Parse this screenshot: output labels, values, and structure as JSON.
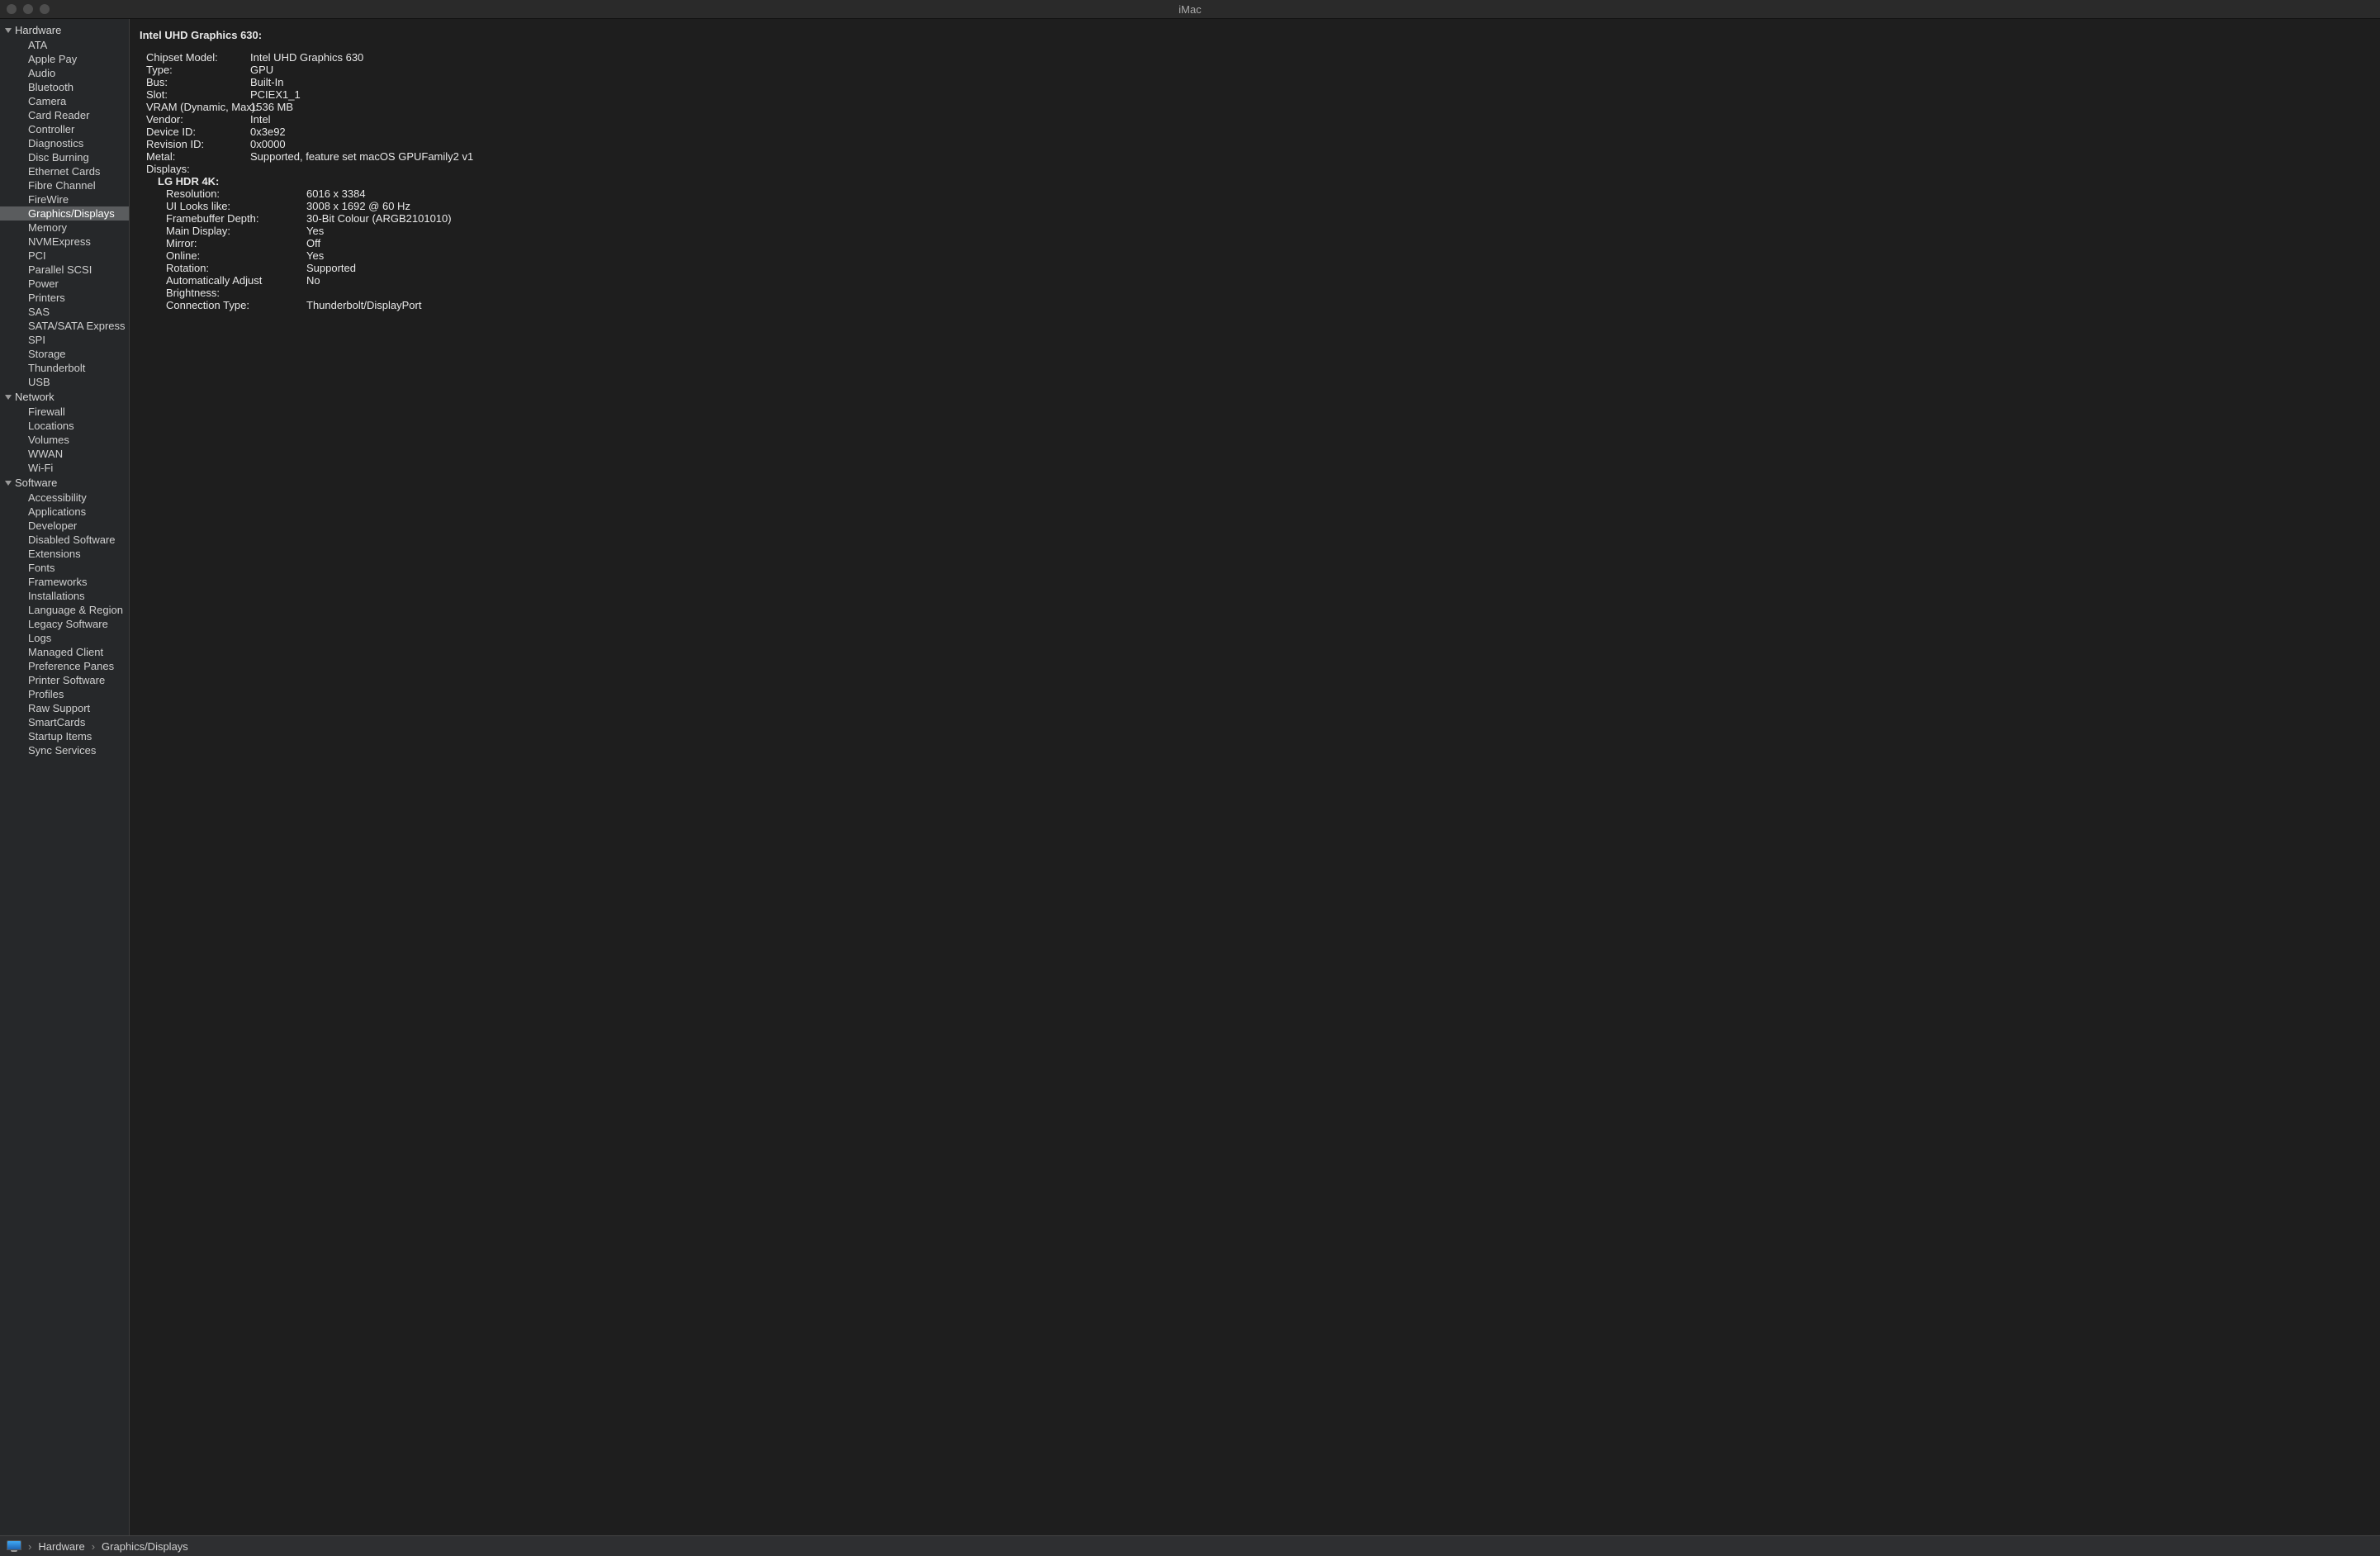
{
  "window": {
    "title": "iMac"
  },
  "sidebar": {
    "sections": [
      {
        "label": "Hardware",
        "items": [
          "ATA",
          "Apple Pay",
          "Audio",
          "Bluetooth",
          "Camera",
          "Card Reader",
          "Controller",
          "Diagnostics",
          "Disc Burning",
          "Ethernet Cards",
          "Fibre Channel",
          "FireWire",
          "Graphics/Displays",
          "Memory",
          "NVMExpress",
          "PCI",
          "Parallel SCSI",
          "Power",
          "Printers",
          "SAS",
          "SATA/SATA Express",
          "SPI",
          "Storage",
          "Thunderbolt",
          "USB"
        ],
        "selected": "Graphics/Displays"
      },
      {
        "label": "Network",
        "items": [
          "Firewall",
          "Locations",
          "Volumes",
          "WWAN",
          "Wi-Fi"
        ]
      },
      {
        "label": "Software",
        "items": [
          "Accessibility",
          "Applications",
          "Developer",
          "Disabled Software",
          "Extensions",
          "Fonts",
          "Frameworks",
          "Installations",
          "Language & Region",
          "Legacy Software",
          "Logs",
          "Managed Client",
          "Preference Panes",
          "Printer Software",
          "Profiles",
          "Raw Support",
          "SmartCards",
          "Startup Items",
          "Sync Services"
        ]
      }
    ]
  },
  "detail": {
    "title": "Intel UHD Graphics 630:",
    "rows": [
      {
        "k": "Chipset Model:",
        "v": "Intel UHD Graphics 630"
      },
      {
        "k": "Type:",
        "v": "GPU"
      },
      {
        "k": "Bus:",
        "v": "Built-In"
      },
      {
        "k": "Slot:",
        "v": "PCIEX1_1"
      },
      {
        "k": "VRAM (Dynamic, Max):",
        "v": "1536 MB"
      },
      {
        "k": "Vendor:",
        "v": "Intel"
      },
      {
        "k": "Device ID:",
        "v": "0x3e92"
      },
      {
        "k": "Revision ID:",
        "v": "0x0000"
      },
      {
        "k": "Metal:",
        "v": "Supported, feature set macOS GPUFamily2 v1"
      }
    ],
    "displays_label": "Displays:",
    "display_name": "LG HDR 4K:",
    "display_rows": [
      {
        "k": "Resolution:",
        "v": "6016 x 3384"
      },
      {
        "k": "UI Looks like:",
        "v": "3008 x 1692 @ 60 Hz"
      },
      {
        "k": "Framebuffer Depth:",
        "v": "30-Bit Colour (ARGB2101010)"
      },
      {
        "k": "Main Display:",
        "v": "Yes"
      },
      {
        "k": "Mirror:",
        "v": "Off"
      },
      {
        "k": "Online:",
        "v": "Yes"
      },
      {
        "k": "Rotation:",
        "v": "Supported"
      },
      {
        "k": "Automatically Adjust Brightness:",
        "v": "No"
      },
      {
        "k": "Connection Type:",
        "v": "Thunderbolt/DisplayPort"
      }
    ]
  },
  "breadcrumb": {
    "items": [
      "Hardware",
      "Graphics/Displays"
    ]
  }
}
